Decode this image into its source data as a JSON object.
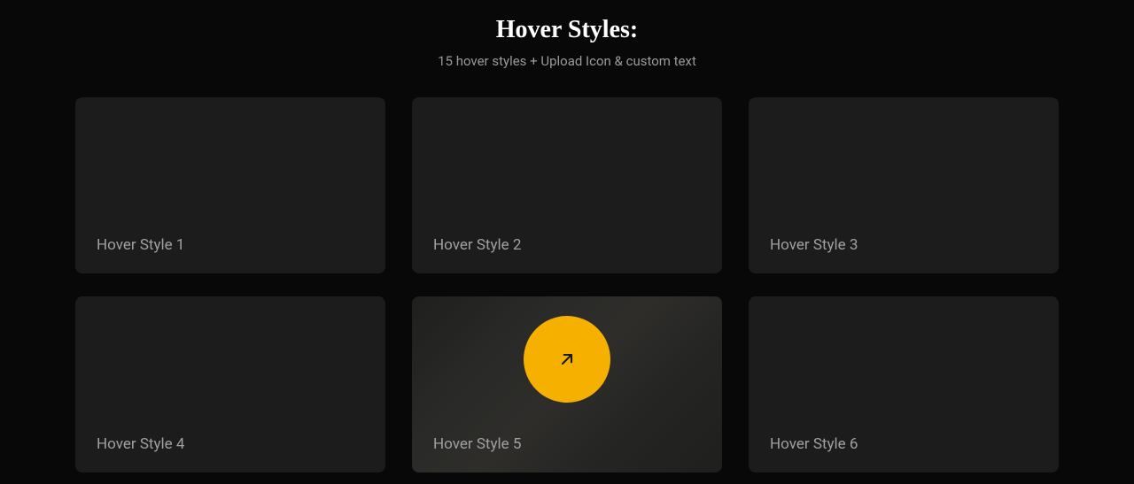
{
  "header": {
    "title": "Hover Styles:",
    "subtitle": "15 hover styles + Upload Icon & custom text"
  },
  "cards": [
    {
      "label": "Hover Style 1",
      "hovered": false
    },
    {
      "label": "Hover Style 2",
      "hovered": false
    },
    {
      "label": "Hover Style 3",
      "hovered": false
    },
    {
      "label": "Hover Style 4",
      "hovered": false
    },
    {
      "label": "Hover Style 5",
      "hovered": true
    },
    {
      "label": "Hover Style 6",
      "hovered": false
    }
  ],
  "icons": {
    "hover_icon": "arrow-up-right-icon"
  },
  "colors": {
    "accent": "#f6b000",
    "background": "#080808",
    "card": "#1c1c1c"
  }
}
